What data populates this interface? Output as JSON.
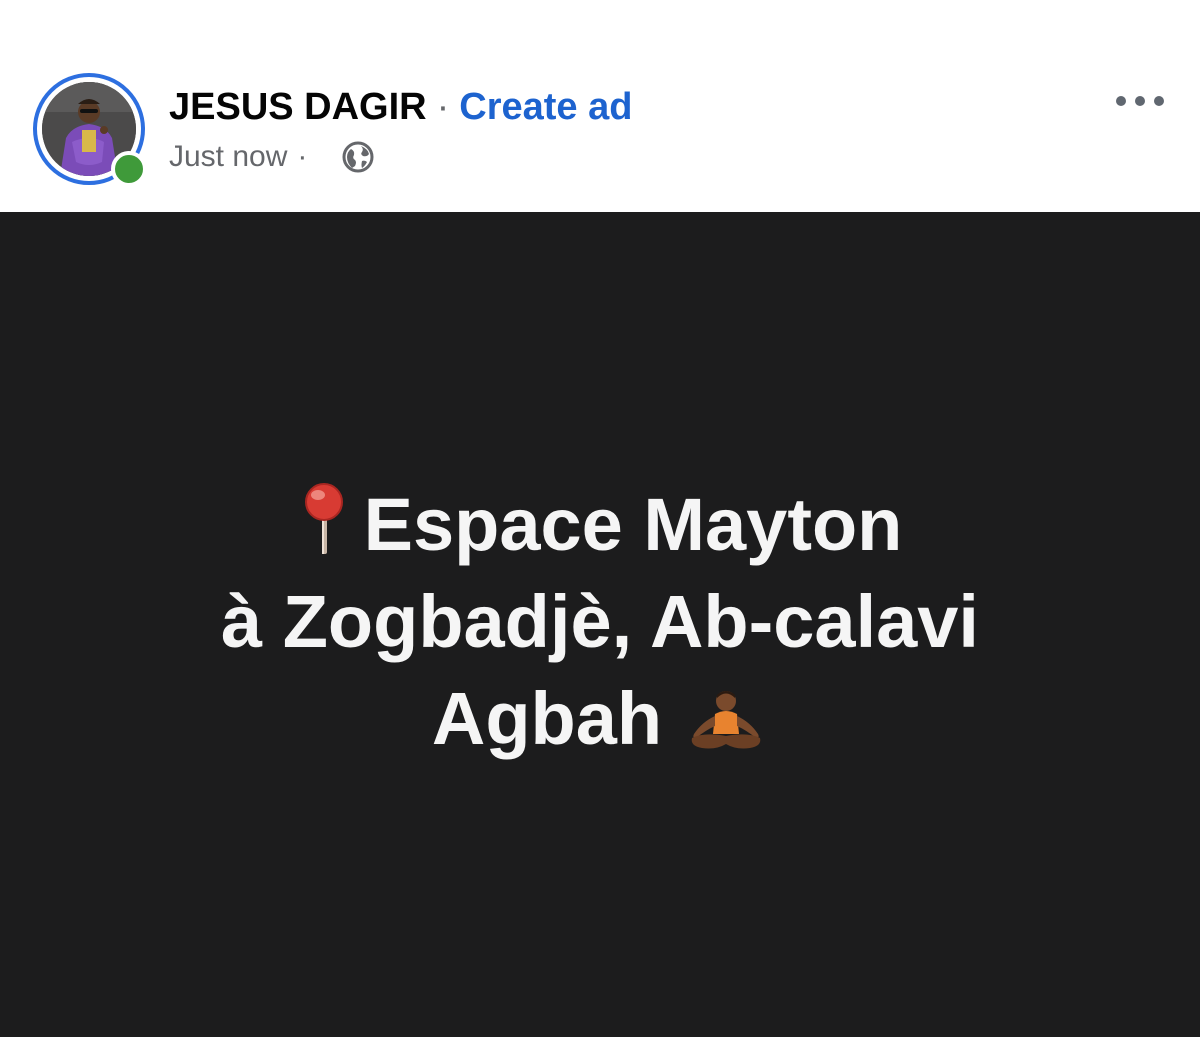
{
  "post": {
    "author": "JESUS DAGIR",
    "separator": "·",
    "create_ad": "Create ad",
    "timestamp": "Just now",
    "meta_separator": "·",
    "privacy_icon": "globe-icon",
    "more_icon": "more-options-icon",
    "status": "online",
    "text_lines": [
      "Espace Mayton",
      "à Zogbadjè, Ab-calavi",
      "Agbah"
    ],
    "emoji": [
      "round-pushpin",
      "person-in-lotus-position"
    ]
  },
  "colors": {
    "name": "#050505",
    "link": "#1d63cf",
    "meta": "#65676b",
    "ring": "#2d6fe0",
    "online": "#3f9a3a",
    "post_background": "#1c1c1d",
    "post_text": "#f5f5f5"
  }
}
